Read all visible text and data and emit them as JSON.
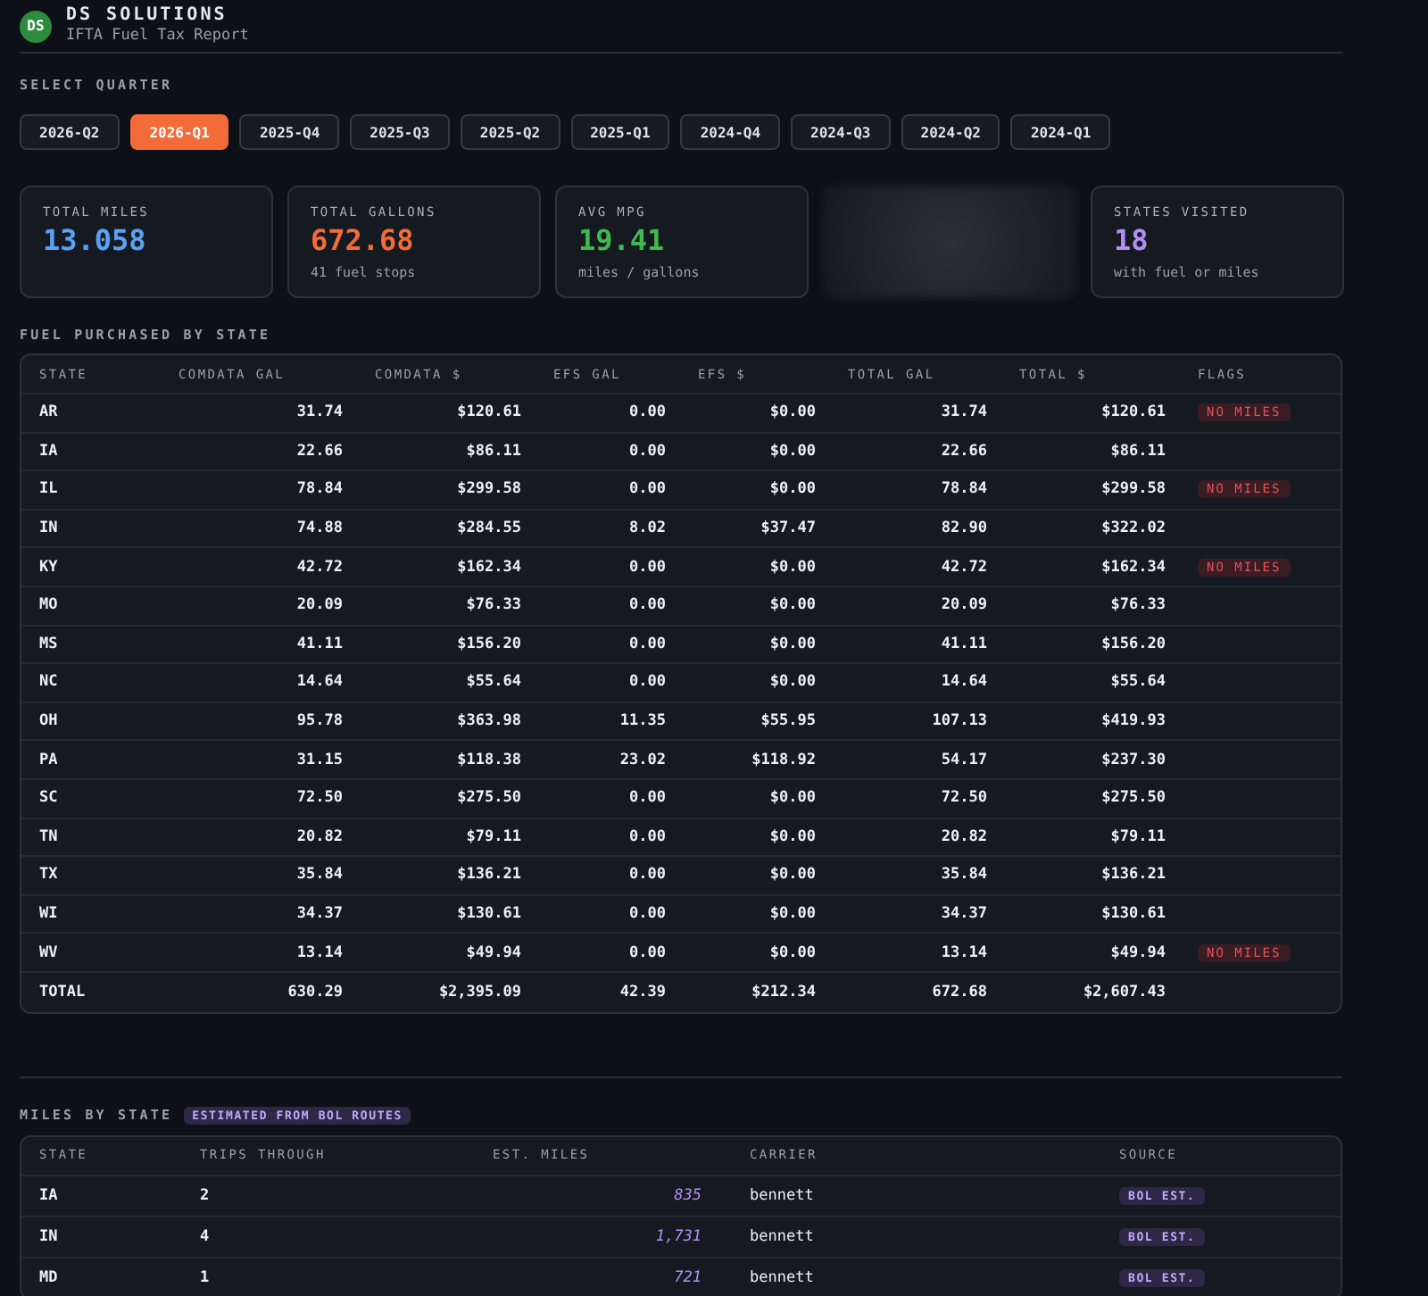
{
  "brand": {
    "logo": "DS",
    "name": "DS SOLUTIONS",
    "subtitle": "IFTA Fuel Tax Report"
  },
  "quarter_picker": {
    "label": "SELECT QUARTER",
    "quarters": [
      {
        "label": "2026-Q2",
        "selected": false
      },
      {
        "label": "2026-Q1",
        "selected": true
      },
      {
        "label": "2025-Q4",
        "selected": false
      },
      {
        "label": "2025-Q3",
        "selected": false
      },
      {
        "label": "2025-Q2",
        "selected": false
      },
      {
        "label": "2025-Q1",
        "selected": false
      },
      {
        "label": "2024-Q4",
        "selected": false
      },
      {
        "label": "2024-Q3",
        "selected": false
      },
      {
        "label": "2024-Q2",
        "selected": false
      },
      {
        "label": "2024-Q1",
        "selected": false
      }
    ]
  },
  "stats": [
    {
      "kind": "stat",
      "label": "TOTAL MILES",
      "value": "13.058",
      "color": "#5aa2f5"
    },
    {
      "kind": "stat",
      "label": "TOTAL GALLONS",
      "value": "672.68",
      "note": "41 fuel stops",
      "color": "#f26b38"
    },
    {
      "kind": "stat",
      "label": "AVG MPG",
      "value": "19.41",
      "note": "miles / gallons",
      "color": "#3fb950"
    },
    {
      "kind": "hidden"
    },
    {
      "kind": "stat",
      "label": "STATES VISITED",
      "value": "18",
      "note": "with fuel or miles",
      "color": "#b48ef5"
    }
  ],
  "fuel_table": {
    "title": "FUEL PURCHASED BY STATE",
    "columns": [
      "STATE",
      "COMDATA GAL",
      "COMDATA $",
      "EFS GAL",
      "EFS $",
      "TOTAL GAL",
      "TOTAL $",
      "FLAGS"
    ],
    "rows": [
      {
        "cells": [
          "AR",
          "31.74",
          "$120.61",
          "0.00",
          "$0.00",
          "31.74",
          "$120.61"
        ],
        "flags": [
          "NO MILES"
        ]
      },
      {
        "cells": [
          "IA",
          "22.66",
          "$86.11",
          "0.00",
          "$0.00",
          "22.66",
          "$86.11"
        ],
        "flags": []
      },
      {
        "cells": [
          "IL",
          "78.84",
          "$299.58",
          "0.00",
          "$0.00",
          "78.84",
          "$299.58"
        ],
        "flags": [
          "NO MILES"
        ]
      },
      {
        "cells": [
          "IN",
          "74.88",
          "$284.55",
          "8.02",
          "$37.47",
          "82.90",
          "$322.02"
        ],
        "flags": []
      },
      {
        "cells": [
          "KY",
          "42.72",
          "$162.34",
          "0.00",
          "$0.00",
          "42.72",
          "$162.34"
        ],
        "flags": [
          "NO MILES"
        ]
      },
      {
        "cells": [
          "MO",
          "20.09",
          "$76.33",
          "0.00",
          "$0.00",
          "20.09",
          "$76.33"
        ],
        "flags": []
      },
      {
        "cells": [
          "MS",
          "41.11",
          "$156.20",
          "0.00",
          "$0.00",
          "41.11",
          "$156.20"
        ],
        "flags": []
      },
      {
        "cells": [
          "NC",
          "14.64",
          "$55.64",
          "0.00",
          "$0.00",
          "14.64",
          "$55.64"
        ],
        "flags": []
      },
      {
        "cells": [
          "OH",
          "95.78",
          "$363.98",
          "11.35",
          "$55.95",
          "107.13",
          "$419.93"
        ],
        "flags": []
      },
      {
        "cells": [
          "PA",
          "31.15",
          "$118.38",
          "23.02",
          "$118.92",
          "54.17",
          "$237.30"
        ],
        "flags": []
      },
      {
        "cells": [
          "SC",
          "72.50",
          "$275.50",
          "0.00",
          "$0.00",
          "72.50",
          "$275.50"
        ],
        "flags": []
      },
      {
        "cells": [
          "TN",
          "20.82",
          "$79.11",
          "0.00",
          "$0.00",
          "20.82",
          "$79.11"
        ],
        "flags": []
      },
      {
        "cells": [
          "TX",
          "35.84",
          "$136.21",
          "0.00",
          "$0.00",
          "35.84",
          "$136.21"
        ],
        "flags": []
      },
      {
        "cells": [
          "WI",
          "34.37",
          "$130.61",
          "0.00",
          "$0.00",
          "34.37",
          "$130.61"
        ],
        "flags": []
      },
      {
        "cells": [
          "WV",
          "13.14",
          "$49.94",
          "0.00",
          "$0.00",
          "13.14",
          "$49.94"
        ],
        "flags": [
          "NO MILES"
        ]
      }
    ],
    "total": [
      "TOTAL",
      "630.29",
      "$2,395.09",
      "42.39",
      "$212.34",
      "672.68",
      "$2,607.43"
    ]
  },
  "miles_table": {
    "title": "MILES BY STATE",
    "badge": "ESTIMATED FROM BOL ROUTES",
    "columns": [
      "STATE",
      "TRIPS THROUGH",
      "EST. MILES",
      "CARRIER",
      "SOURCE"
    ],
    "rows": [
      {
        "state": "IA",
        "trips": "2",
        "miles": "835",
        "carrier": "bennett",
        "source": "BOL EST."
      },
      {
        "state": "IN",
        "trips": "4",
        "miles": "1,731",
        "carrier": "bennett",
        "source": "BOL EST."
      },
      {
        "state": "MD",
        "trips": "1",
        "miles": "721",
        "carrier": "bennett",
        "source": "BOL EST."
      }
    ]
  }
}
